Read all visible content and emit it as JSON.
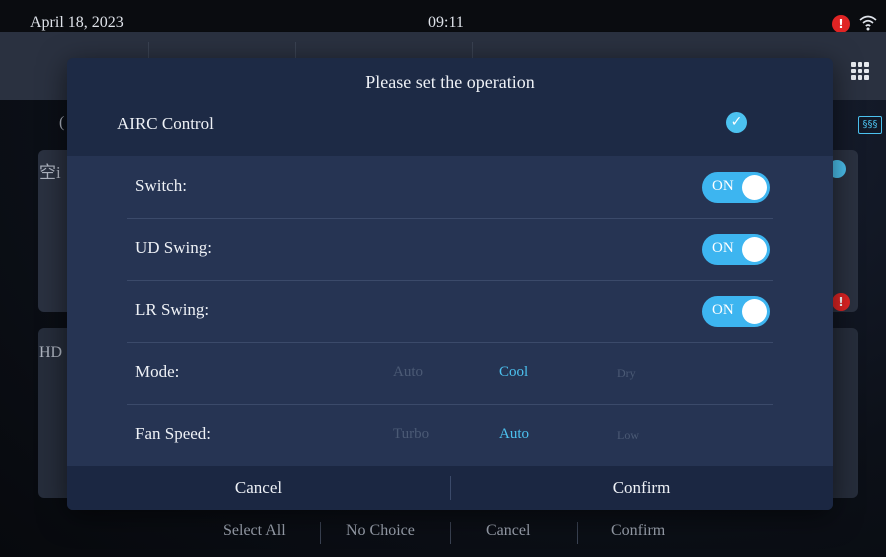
{
  "status_bar": {
    "date": "April 18, 2023",
    "time": "09:11",
    "alert_symbol": "!"
  },
  "background": {
    "partial_label_1": "空i",
    "partial_label_2": "HD",
    "partial_label_3": "(",
    "alert_symbol": "!",
    "heat_icon_text": "§§§",
    "actions": [
      "Select All",
      "No Choice",
      "Cancel",
      "Confirm"
    ]
  },
  "dialog": {
    "title": "Please set the operation",
    "section_label": "AIRC Control",
    "section_checked": true,
    "rows": [
      {
        "label": "Switch:",
        "toggle": "ON"
      },
      {
        "label": "UD Swing:",
        "toggle": "ON"
      },
      {
        "label": "LR Swing:",
        "toggle": "ON"
      },
      {
        "label": "Mode:",
        "options": [
          "Auto",
          "Cool",
          "Dry"
        ],
        "selected": "Cool"
      },
      {
        "label": "Fan Speed:",
        "options": [
          "Turbo",
          "Auto",
          "Low"
        ],
        "selected": "Auto"
      }
    ],
    "cancel": "Cancel",
    "confirm": "Confirm"
  },
  "icons": {
    "alert": "alert-icon",
    "wifi": "wifi-icon",
    "grid": "grid-menu-icon",
    "check": "check-circle-icon",
    "heat": "heater-icon"
  },
  "colors": {
    "accent": "#4cc2f0",
    "toggle_on": "#3db5f0",
    "alert": "#e02424",
    "dialog_bg": "#1d2a45"
  }
}
